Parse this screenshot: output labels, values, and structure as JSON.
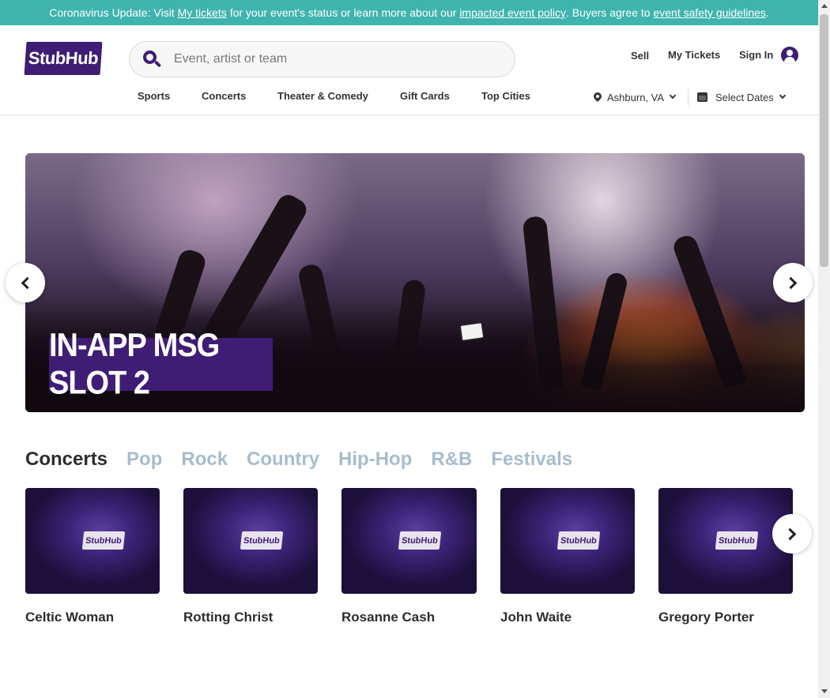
{
  "banner": {
    "prefix": "Coronavirus Update: Visit ",
    "link1": "My tickets",
    "mid1": " for your event's status or learn more about our ",
    "link2": "impacted event policy",
    "mid2": ". Buyers agree to ",
    "link3": "event safety guidelines",
    "suffix": "."
  },
  "header": {
    "logo": "StubHub",
    "search_placeholder": "Event, artist or team",
    "sell": "Sell",
    "my_tickets": "My Tickets",
    "sign_in": "Sign In"
  },
  "nav": {
    "items": [
      "Sports",
      "Concerts",
      "Theater & Comedy",
      "Gift Cards",
      "Top Cities"
    ],
    "location": "Ashburn, VA",
    "dates": "Select Dates"
  },
  "hero": {
    "message": "IN-APP MSG SLOT 2"
  },
  "categories": {
    "tabs": [
      "Concerts",
      "Pop",
      "Rock",
      "Country",
      "Hip-Hop",
      "R&B",
      "Festivals"
    ],
    "active": "Concerts"
  },
  "cards": [
    {
      "name": "Celtic Woman",
      "badge": "StubHub"
    },
    {
      "name": "Rotting Christ",
      "badge": "StubHub"
    },
    {
      "name": "Rosanne Cash",
      "badge": "StubHub"
    },
    {
      "name": "John Waite",
      "badge": "StubHub"
    },
    {
      "name": "Gregory Porter",
      "badge": "StubHub"
    }
  ],
  "colors": {
    "banner": "#3fb4ad",
    "brand": "#3f1d74",
    "inactive_tab": "#a7bccd"
  },
  "icons": [
    "search-icon",
    "user-icon",
    "location-pin-icon",
    "calendar-icon",
    "chevron-down-icon",
    "chevron-left-icon",
    "chevron-right-icon"
  ]
}
